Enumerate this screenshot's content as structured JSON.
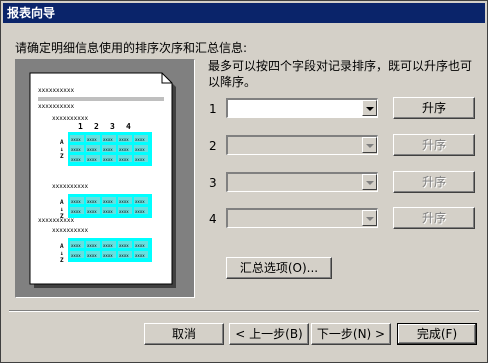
{
  "window": {
    "title": "报表向导"
  },
  "instruction": "请确定明细信息使用的排序次序和汇总信息:",
  "description": "最多可以按四个字段对记录排序，既可以升序也可以降序。",
  "preview": {
    "placeholder": "xxxxxxxxxx",
    "columns": [
      "1",
      "2",
      "3",
      "4"
    ],
    "sort_glyph": "A↓Z",
    "cell_text": "xxxx"
  },
  "sort_rows": [
    {
      "number": "1",
      "value": "",
      "enabled": true,
      "order_label": "升序"
    },
    {
      "number": "2",
      "value": "",
      "enabled": false,
      "order_label": "升序"
    },
    {
      "number": "3",
      "value": "",
      "enabled": false,
      "order_label": "升序"
    },
    {
      "number": "4",
      "value": "",
      "enabled": false,
      "order_label": "升序"
    }
  ],
  "summary_button": "汇总选项(O)...",
  "footer": {
    "cancel": "取消",
    "back": "< 上一步(B)",
    "next": "下一步(N) >",
    "finish": "完成(F)"
  }
}
